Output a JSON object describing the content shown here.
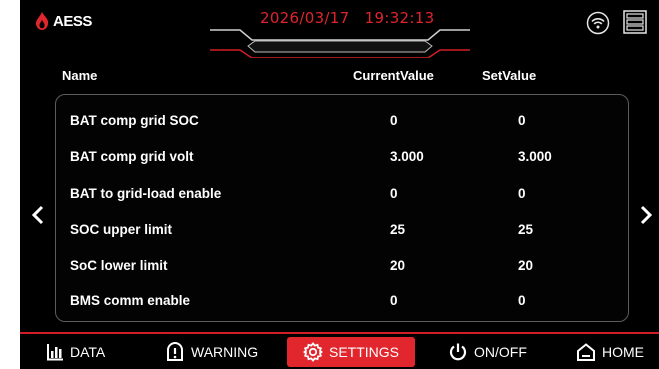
{
  "brand": {
    "name": "AESS"
  },
  "header": {
    "datetime": "2026/03/17   19:32:13"
  },
  "table": {
    "columns": {
      "name": "Name",
      "current": "CurrentValue",
      "set": "SetValue"
    },
    "rows": [
      {
        "name": "BAT comp grid SOC",
        "current": "0",
        "set": "0"
      },
      {
        "name": "BAT comp grid volt",
        "current": "3.000",
        "set": "3.000"
      },
      {
        "name": "BAT to grid-load enable",
        "current": "0",
        "set": "0"
      },
      {
        "name": "SOC upper limit",
        "current": "25",
        "set": "25"
      },
      {
        "name": "SoC lower limit",
        "current": "20",
        "set": "20"
      },
      {
        "name": "BMS comm enable",
        "current": "0",
        "set": "0"
      }
    ]
  },
  "pager": {
    "prev": "‹",
    "next": "›"
  },
  "nav": {
    "data": "DATA",
    "warning": "WARNING",
    "settings": "SETTINGS",
    "onoff": "ON/OFF",
    "home": "HOME"
  },
  "colors": {
    "accent": "#e1262d",
    "datetime": "#e0232c",
    "background": "#000000"
  }
}
